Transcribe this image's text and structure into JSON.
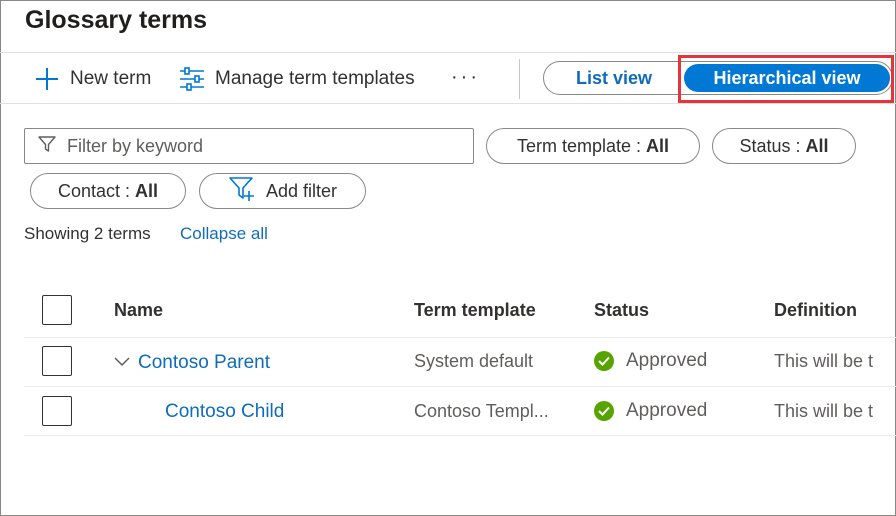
{
  "page": {
    "title": "Glossary terms"
  },
  "toolbar": {
    "new_term_label": "New term",
    "manage_templates_label": "Manage term templates",
    "more_label": "···",
    "list_view_label": "List view",
    "hierarchical_view_label": "Hierarchical view",
    "active_view": "Hierarchical view"
  },
  "filters": {
    "keyword_placeholder": "Filter by keyword",
    "term_template_label": "Term template :",
    "term_template_value": "All",
    "status_label": "Status :",
    "status_value": "All",
    "contact_label": "Contact :",
    "contact_value": "All",
    "add_filter_label": "Add filter"
  },
  "summary": {
    "showing_text": "Showing 2 terms",
    "collapse_all_label": "Collapse all"
  },
  "table": {
    "columns": [
      "Name",
      "Term template",
      "Status",
      "Definition"
    ],
    "rows": [
      {
        "name": "Contoso Parent",
        "term_template": "System default",
        "status": "Approved",
        "definition": "This will be t",
        "expanded": true
      },
      {
        "name": "Contoso Child",
        "term_template": "Contoso Templ...",
        "status": "Approved",
        "definition": "This will be t"
      }
    ]
  },
  "colors": {
    "accent": "#0078d4",
    "link": "#0f6cbd",
    "approved": "#57a300",
    "highlight": "#e8323c"
  },
  "icons": [
    "plus-icon",
    "sliders-icon",
    "more-icon",
    "filter-icon",
    "add-filter-icon",
    "chevron-down-icon",
    "check-circle-icon"
  ]
}
